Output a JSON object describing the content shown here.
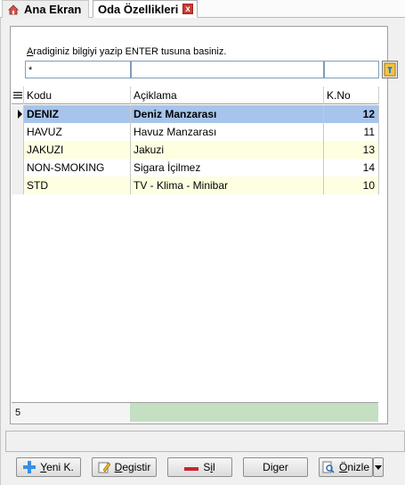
{
  "tabs": {
    "home_label": "Ana Ekran",
    "active_label": "Oda Özellikleri",
    "close_glyph": "x"
  },
  "search": {
    "hint": "Aradiginiz bilgiyi yazip ENTER tusuna basiniz.",
    "hint_first_letter": "A",
    "hint_rest": "radiginiz bilgiyi yazip ENTER tusuna basiniz.",
    "filter_code_value": "*",
    "filter_desc_value": "",
    "filter_no_value": ""
  },
  "table": {
    "columns": [
      "Kodu",
      "Açiklama",
      "K.No"
    ],
    "rows": [
      {
        "code": "DENIZ",
        "desc": "Deniz Manzarası",
        "no": "12"
      },
      {
        "code": "HAVUZ",
        "desc": "Havuz Manzarası",
        "no": "11"
      },
      {
        "code": "JAKUZI",
        "desc": "Jakuzi",
        "no": "13"
      },
      {
        "code": "NON-SMOKING",
        "desc": "Sigara İçilmez",
        "no": "14"
      },
      {
        "code": "STD",
        "desc": "TV - Klima - Minibar",
        "no": "10"
      }
    ],
    "selected_row_index": 0,
    "footer_count": "5"
  },
  "buttons": {
    "new": {
      "u": "Y",
      "rest": "eni K."
    },
    "edit": {
      "u": "D",
      "rest": "egistir"
    },
    "delete": {
      "pre": "S",
      "u": "i",
      "rest": "l"
    },
    "other": "Diger",
    "preview": {
      "u": "Ö",
      "rest": "nizle"
    }
  },
  "colors": {
    "selected_row": "#a6c4ec",
    "alt_row": "#fefee1",
    "footer_green": "#c4dfc2",
    "close_red": "#cc3a2f"
  }
}
